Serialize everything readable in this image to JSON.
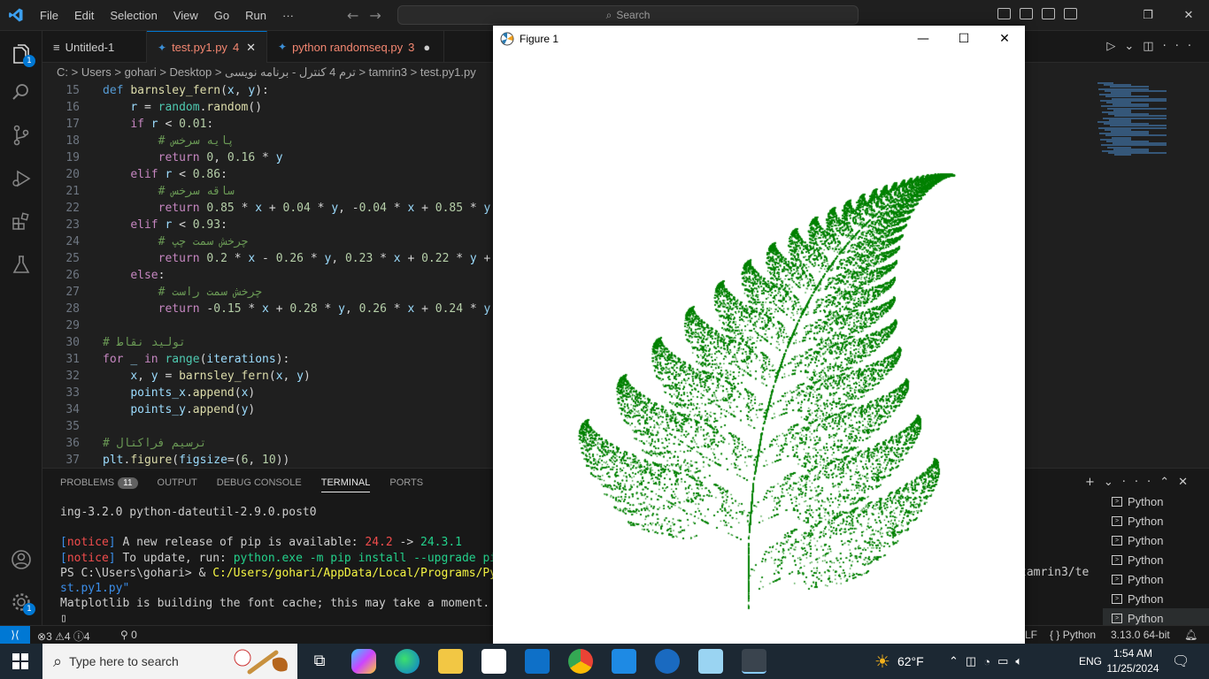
{
  "menu": [
    "File",
    "Edit",
    "Selection",
    "View",
    "Go",
    "Run",
    "···"
  ],
  "search": {
    "label": "Search"
  },
  "activity": {
    "explorer_badge": "1",
    "accounts_badge": "1"
  },
  "tabs": [
    {
      "label": "Untitled-1",
      "suffix": ""
    },
    {
      "label": "test.py1.py",
      "suffix": "4"
    },
    {
      "label": "python randomseq.py",
      "suffix": "3"
    }
  ],
  "breadcrumb": "C: > Users > gohari > Desktop > ترم 4 کنترل - برنامه نویسی > tamrin3 > test.py1.py",
  "code": [
    {
      "n": "15",
      "html": "<span class='def'>def</span> <span class='fn'>barnsley_fern</span><span class='pl'>(</span><span class='var'>x</span><span class='pl'>, </span><span class='var'>y</span><span class='pl'>):</span>"
    },
    {
      "n": "16",
      "html": "    <span class='var'>r</span> <span class='pl'>= </span><span class='bi'>random</span><span class='pl'>.</span><span class='fn'>random</span><span class='pl'>()</span>"
    },
    {
      "n": "17",
      "html": "    <span class='kw'>if</span> <span class='var'>r</span> <span class='pl'>&lt; </span><span class='num'>0.01</span><span class='pl'>:</span>"
    },
    {
      "n": "18",
      "html": "        <span class='cm'># پایه سرخس</span>"
    },
    {
      "n": "19",
      "html": "        <span class='kw'>return</span> <span class='num'>0</span><span class='pl'>, </span><span class='num'>0.16</span> <span class='pl'>* </span><span class='var'>y</span>"
    },
    {
      "n": "20",
      "html": "    <span class='kw'>elif</span> <span class='var'>r</span> <span class='pl'>&lt; </span><span class='num'>0.86</span><span class='pl'>:</span>"
    },
    {
      "n": "21",
      "html": "        <span class='cm'># ساقه سرخس</span>"
    },
    {
      "n": "22",
      "html": "        <span class='kw'>return</span> <span class='num'>0.85</span> <span class='pl'>* </span><span class='var'>x</span> <span class='pl'>+ </span><span class='num'>0.04</span> <span class='pl'>* </span><span class='var'>y</span><span class='pl'>, -</span><span class='num'>0.04</span> <span class='pl'>* </span><span class='var'>x</span> <span class='pl'>+ </span><span class='num'>0.85</span> <span class='pl'>* </span><span class='var'>y</span>"
    },
    {
      "n": "23",
      "html": "    <span class='kw'>elif</span> <span class='var'>r</span> <span class='pl'>&lt; </span><span class='num'>0.93</span><span class='pl'>:</span>"
    },
    {
      "n": "24",
      "html": "        <span class='cm'># چرخش سمت چپ</span>"
    },
    {
      "n": "25",
      "html": "        <span class='kw'>return</span> <span class='num'>0.2</span> <span class='pl'>* </span><span class='var'>x</span> <span class='pl'>- </span><span class='num'>0.26</span> <span class='pl'>* </span><span class='var'>y</span><span class='pl'>, </span><span class='num'>0.23</span> <span class='pl'>* </span><span class='var'>x</span> <span class='pl'>+ </span><span class='num'>0.22</span> <span class='pl'>* </span><span class='var'>y</span> <span class='pl'>+</span>"
    },
    {
      "n": "26",
      "html": "    <span class='kw'>else</span><span class='pl'>:</span>"
    },
    {
      "n": "27",
      "html": "        <span class='cm'># چرخش سمت راست</span>"
    },
    {
      "n": "28",
      "html": "        <span class='kw'>return</span> <span class='pl'>-</span><span class='num'>0.15</span> <span class='pl'>* </span><span class='var'>x</span> <span class='pl'>+ </span><span class='num'>0.28</span> <span class='pl'>* </span><span class='var'>y</span><span class='pl'>, </span><span class='num'>0.26</span> <span class='pl'>* </span><span class='var'>x</span> <span class='pl'>+ </span><span class='num'>0.24</span> <span class='pl'>* </span><span class='var'>y</span>"
    },
    {
      "n": "29",
      "html": ""
    },
    {
      "n": "30",
      "html": "<span class='cm'># تولید نقاط</span>"
    },
    {
      "n": "31",
      "html": "<span class='kw'>for</span> <span class='var'>_</span> <span class='kw'>in</span> <span class='bi'>range</span><span class='pl'>(</span><span class='var'>iterations</span><span class='pl'>):</span>"
    },
    {
      "n": "32",
      "html": "    <span class='var'>x</span><span class='pl'>, </span><span class='var'>y</span> <span class='pl'>= </span><span class='fn'>barnsley_fern</span><span class='pl'>(</span><span class='var'>x</span><span class='pl'>, </span><span class='var'>y</span><span class='pl'>)</span>"
    },
    {
      "n": "33",
      "html": "    <span class='var'>points_x</span><span class='pl'>.</span><span class='fn'>append</span><span class='pl'>(</span><span class='var'>x</span><span class='pl'>)</span>"
    },
    {
      "n": "34",
      "html": "    <span class='var'>points_y</span><span class='pl'>.</span><span class='fn'>append</span><span class='pl'>(</span><span class='var'>y</span><span class='pl'>)</span>"
    },
    {
      "n": "35",
      "html": ""
    },
    {
      "n": "36",
      "html": "<span class='cm'># ترسیم فراکتال</span>"
    },
    {
      "n": "37",
      "html": "<span class='var'>plt</span><span class='pl'>.</span><span class='fn'>figure</span><span class='pl'>(</span><span class='var'>figsize</span><span class='pl'>=(</span><span class='num'>6</span><span class='pl'>, </span><span class='num'>10</span><span class='pl'>))</span>"
    }
  ],
  "panel": {
    "tabs": [
      "PROBLEMS",
      "OUTPUT",
      "DEBUG CONSOLE",
      "TERMINAL",
      "PORTS"
    ],
    "problems_count": "11",
    "terminal_lines": [
      "ing-3.2.0 python-dateutil-2.9.0.post0",
      "",
      "<span class='t-blue'>[</span><span class='t-red'>notice</span><span class='t-blue'>]</span> A new release of pip is available: <span class='t-red'>24.2</span> -> <span class='t-green'>24.3.1</span>",
      "<span class='t-blue'>[</span><span class='t-red'>notice</span><span class='t-blue'>]</span> To update, run: <span class='t-green'>python.exe -m pip install --upgrade pip</span>",
      "PS C:\\Users\\gohari> & <span class='t-yellow'>C:/Users/gohari/AppData/Local/Programs/Pyt</span>",
      "<span class='t-blue'>st.py1.py\"</span>",
      "Matplotlib is building the font cache; this may take a moment.",
      "▯"
    ],
    "terminal_overflow_right": "tamrin3/te",
    "terminals": [
      "Python",
      "Python",
      "Python",
      "Python",
      "Python",
      "Python",
      "Python"
    ]
  },
  "status": {
    "errors": "3",
    "warnings": "4",
    "info": "4",
    "ports": "0",
    "eol": "LF",
    "language": "Python",
    "interpreter": "3.13.0 64-bit"
  },
  "figure": {
    "title": "Figure 1",
    "fern_color": "#008000"
  },
  "taskbar": {
    "search_placeholder": "Type here to search",
    "weather": "62°F",
    "language": "ENG",
    "time": "1:54 AM",
    "date": "11/25/2024"
  }
}
